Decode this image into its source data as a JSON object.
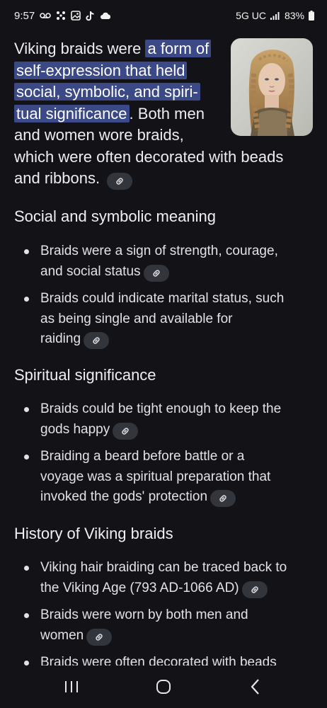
{
  "status_bar": {
    "time": "9:57",
    "network": "5G UC",
    "battery": "83%",
    "icons": [
      "voicemail-icon",
      "dots-grid-icon",
      "gallery-icon",
      "tiktok-icon",
      "cloud-icon",
      "signal-icon",
      "battery-icon"
    ]
  },
  "hero_image": {
    "description_icon": "portrait-image"
  },
  "intro": {
    "l1_plain": "Viking braids were ",
    "l1_hl": "a form of",
    "l2_hl": "self-expression that held",
    "l3_hl": "social, symbolic, and spiri-",
    "l4_hl": "tual significance",
    "l4_plain": ". Both men",
    "l5": "and women wore braids,",
    "l6": "which were often decorated with beads",
    "l7": "and ribbons."
  },
  "sections": [
    {
      "title": "Social and symbolic meaning",
      "bullets": [
        {
          "lines": [
            "Braids were a sign of strength, courage,",
            "and social status"
          ]
        },
        {
          "lines": [
            "Braids could indicate marital status, such",
            "as being single and available for",
            "raiding"
          ]
        }
      ]
    },
    {
      "title": "Spiritual significance",
      "bullets": [
        {
          "lines": [
            "Braids could be tight enough to keep the",
            "gods happy"
          ]
        },
        {
          "lines": [
            "Braiding a beard before battle or a",
            "voyage was a spiritual preparation that",
            "invoked the gods' protection"
          ]
        }
      ]
    },
    {
      "title": "History of Viking braids",
      "bullets": [
        {
          "lines": [
            "Viking hair braiding can be traced back to",
            "the Viking Age (793 AD-1066 AD)"
          ]
        },
        {
          "lines": [
            "Braids were worn by both men and",
            "women"
          ]
        },
        {
          "lines": [
            "Braids were often decorated with beads"
          ]
        }
      ]
    }
  ],
  "nav_bar": {
    "icons": [
      "recent-apps-icon",
      "home-icon",
      "back-icon"
    ]
  },
  "colors": {
    "background": "#131317",
    "highlight": "#3b4a86",
    "link_chip": "#33353c"
  }
}
